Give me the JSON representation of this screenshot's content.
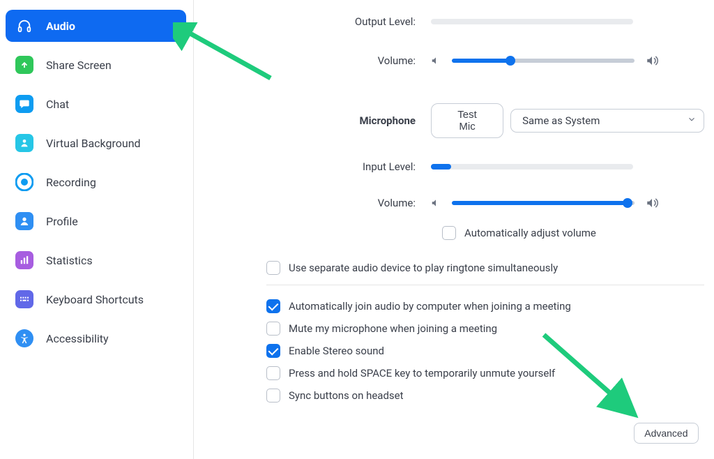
{
  "sidebar": {
    "items": [
      {
        "label": "Audio"
      },
      {
        "label": "Share Screen"
      },
      {
        "label": "Chat"
      },
      {
        "label": "Virtual Background"
      },
      {
        "label": "Recording"
      },
      {
        "label": "Profile"
      },
      {
        "label": "Statistics"
      },
      {
        "label": "Keyboard Shortcuts"
      },
      {
        "label": "Accessibility"
      }
    ]
  },
  "speaker": {
    "output_level_label": "Output Level:",
    "volume_label": "Volume:",
    "volume_pct": 32
  },
  "microphone": {
    "section": "Microphone",
    "test_btn": "Test Mic",
    "device": "Same as System",
    "input_level_label": "Input Level:",
    "input_level_pct": 10,
    "volume_label": "Volume:",
    "volume_pct": 96,
    "auto_adjust_label": "Automatically adjust volume"
  },
  "options": {
    "ringtone": "Use separate audio device to play ringtone simultaneously",
    "auto_join": "Automatically join audio by computer when joining a meeting",
    "mute_on_join": "Mute my microphone when joining a meeting",
    "stereo": "Enable Stereo sound",
    "space_unmute": "Press and hold SPACE key to temporarily unmute yourself",
    "sync_headset": "Sync buttons on headset"
  },
  "advanced_btn": "Advanced"
}
